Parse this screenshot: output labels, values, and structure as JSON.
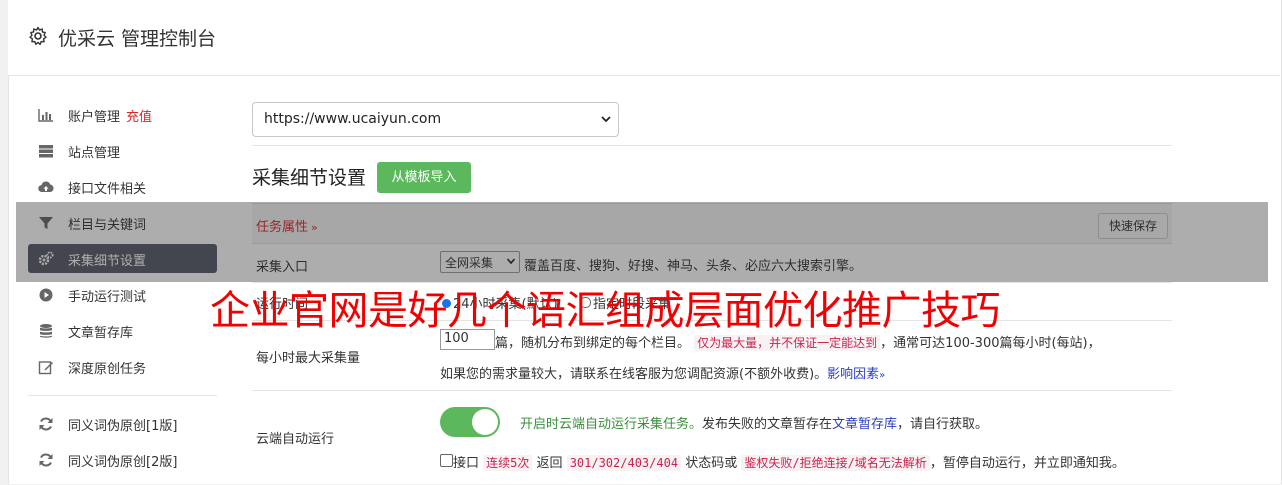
{
  "header": {
    "title": "优采云 管理控制台",
    "icon": "gear-icon"
  },
  "sidebar": {
    "items": [
      {
        "label": "账户管理",
        "extra": "充值",
        "icon": "bar-chart-icon"
      },
      {
        "label": "站点管理",
        "icon": "server-icon"
      },
      {
        "label": "接口文件相关",
        "icon": "cloud-upload-icon"
      },
      {
        "label": "栏目与关键词",
        "icon": "filter-icon"
      },
      {
        "label": "采集细节设置",
        "icon": "gears-icon",
        "active": true
      },
      {
        "label": "手动运行测试",
        "icon": "play-circle-icon"
      },
      {
        "label": "文章暂存库",
        "icon": "database-icon"
      },
      {
        "label": "深度原创任务",
        "icon": "edit-icon"
      },
      {
        "label": "同义词伪原创[1版]",
        "icon": "refresh-icon"
      },
      {
        "label": "同义词伪原创[2版]",
        "icon": "refresh-icon"
      }
    ]
  },
  "site_select": {
    "value": "https://www.ucaiyun.com"
  },
  "section": {
    "title": "采集细节设置",
    "import_button": "从模板导入"
  },
  "task": {
    "label": "任务属性",
    "chevron": "»",
    "quick_save": "快速保存"
  },
  "collect_entry": {
    "label": "采集入口",
    "select_value": "全网采集",
    "desc": "覆盖百度、搜狗、好搜、神马、头条、必应六大搜索引擎。"
  },
  "run_time": {
    "label": "运行时间",
    "option1": "24小时采集(默认)",
    "option2": "指定时段采集"
  },
  "max_per_hour": {
    "label": "每小时最大采集量",
    "value": "100",
    "desc_a": "篇，随机分布到绑定的每个栏目。",
    "note": "仅为最大量，并不保证一定能达到",
    "desc_b": "，通常可达100-300篇每小时(每站)，",
    "line2": "如果您的需求量较大，请联系在线客服为您调配资源(不额外收费)。",
    "link": "影响因素"
  },
  "cloud_run": {
    "label": "云端自动运行",
    "on_text": "开启时云端自动运行采集任务。",
    "desc_a": "发布失败的文章暂存在",
    "link": "文章暂存库",
    "desc_b": "，请自行获取。",
    "cb_label": "接口",
    "code1": "连续5次",
    "t1": "返回",
    "code2": "301/302/403/404",
    "t2": "状态码或",
    "code3": "鉴权失败/拒绝连接/域名无法解析",
    "t3": "，暂停自动运行，并立即通知我。"
  },
  "watermark": {
    "text": "企业官网是好几个语汇组成层面优化推广技巧"
  },
  "colors": {
    "green": "#5cb85c",
    "red": "#d9262a",
    "active_bg": "#555a68",
    "link": "#2a3dbd"
  }
}
